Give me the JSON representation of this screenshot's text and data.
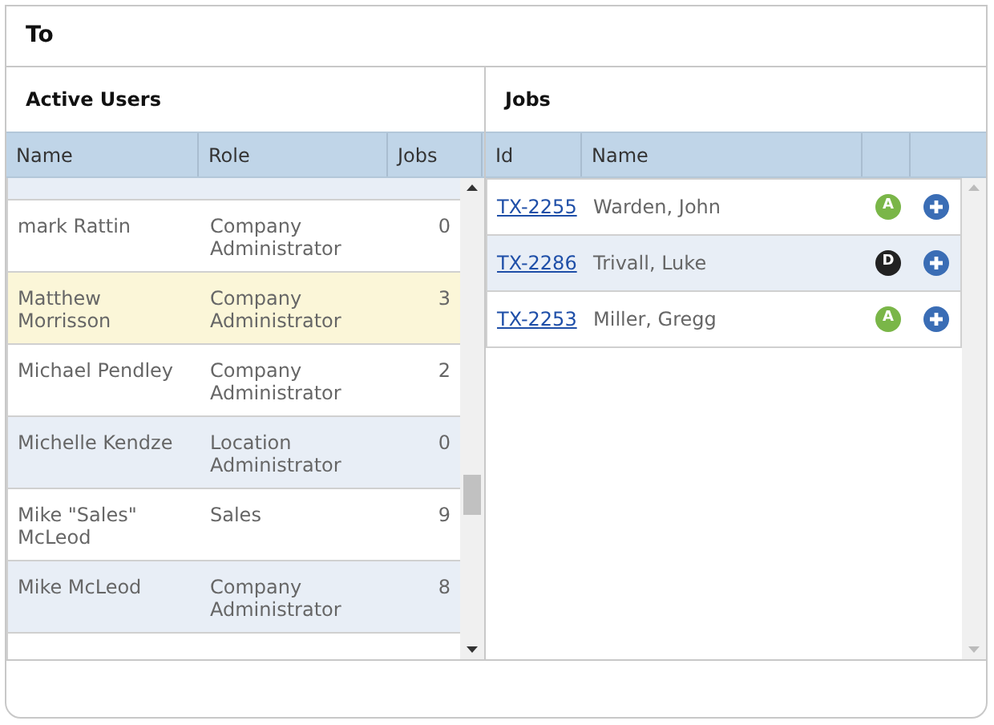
{
  "dialog": {
    "title": "To"
  },
  "users": {
    "title": "Active Users",
    "columns": [
      "Name",
      "Role",
      "Jobs"
    ],
    "rows": [
      {
        "name": "mark Rattin",
        "role": "Company Administrator",
        "jobs": "0",
        "selected": false
      },
      {
        "name": "Matthew Morrisson",
        "role": "Company Administrator",
        "jobs": "3",
        "selected": true
      },
      {
        "name": "Michael Pendley",
        "role": "Company Administrator",
        "jobs": "2",
        "selected": false
      },
      {
        "name": "Michelle Kendze",
        "role": "Location Administrator",
        "jobs": "0",
        "selected": false
      },
      {
        "name": "Mike \"Sales\" McLeod",
        "role": "Sales",
        "jobs": "9",
        "selected": false
      },
      {
        "name": "Mike McLeod",
        "role": "Company Administrator",
        "jobs": "8",
        "selected": false
      }
    ]
  },
  "jobs": {
    "title": "Jobs",
    "columns": [
      "Id",
      "Name"
    ],
    "rows": [
      {
        "id": "TX-2255",
        "name": "Warden, John",
        "status": "A",
        "color": "#7ab648"
      },
      {
        "id": "TX-2286",
        "name": "Trivall, Luke",
        "status": "D",
        "color": "#222222"
      },
      {
        "id": "TX-2253",
        "name": "Miller, Gregg",
        "status": "A",
        "color": "#7ab648"
      }
    ]
  }
}
